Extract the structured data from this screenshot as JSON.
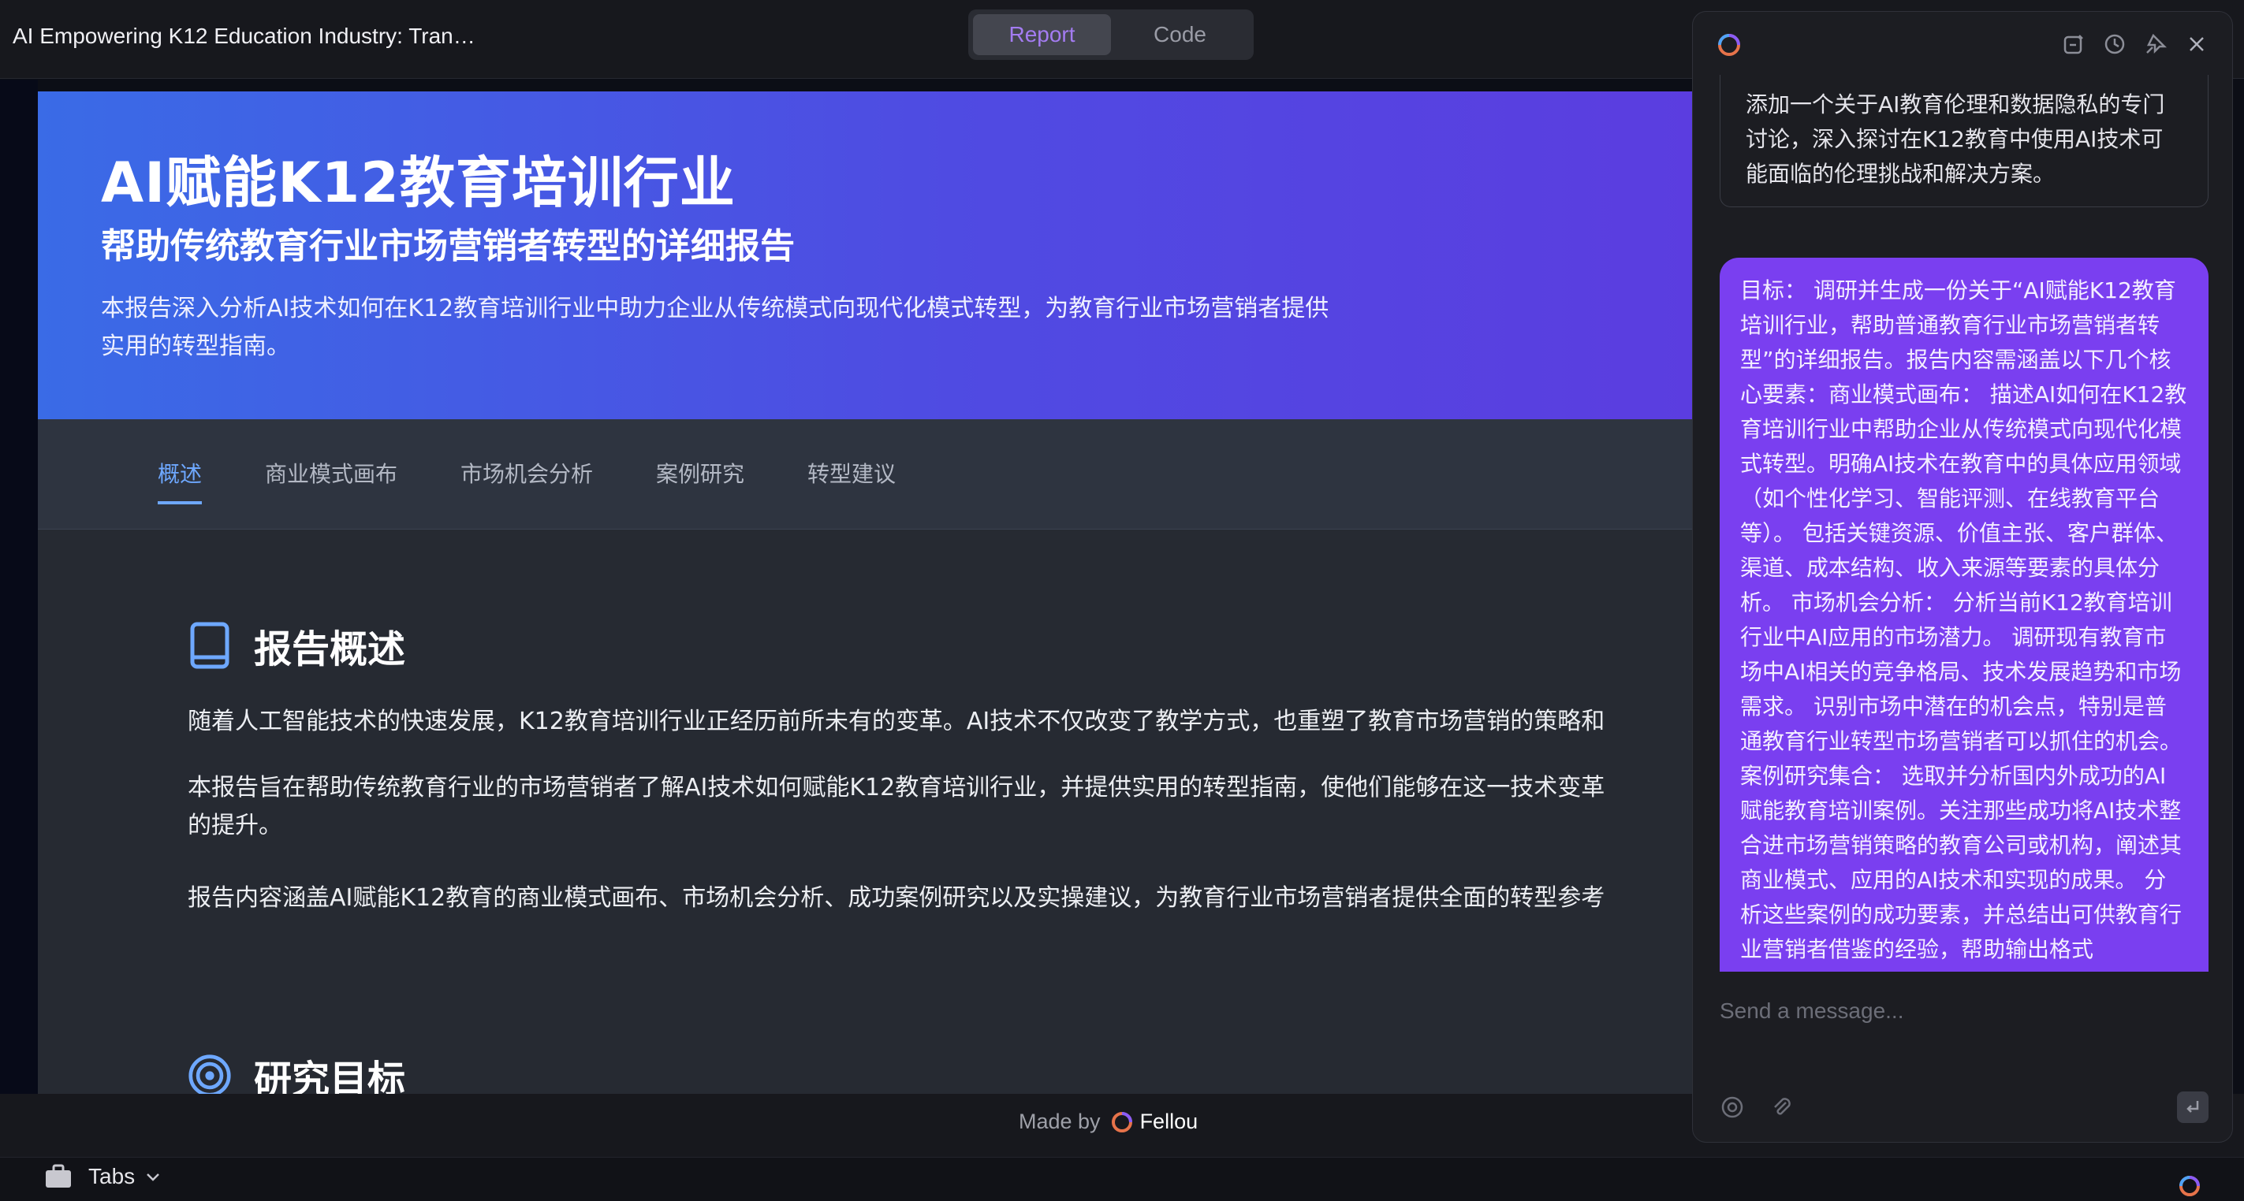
{
  "topbar": {
    "doc_title": "AI Empowering K12 Education Industry: Tran…",
    "segments": [
      "Report",
      "Code"
    ]
  },
  "report": {
    "hero": {
      "title": "AI赋能K12教育培训行业",
      "subtitle": "帮助传统教育行业市场营销者转型的详细报告",
      "description": "本报告深入分析AI技术如何在K12教育培训行业中助力企业从传统模式向现代化模式转型，为教育行业市场营销者提供实用的转型指南。"
    },
    "tabs": [
      "概述",
      "商业模式画布",
      "市场机会分析",
      "案例研究",
      "转型建议"
    ],
    "overview": {
      "heading": "报告概述",
      "paragraphs": [
        "随着人工智能技术的快速发展，K12教育培训行业正经历前所未有的变革。AI技术不仅改变了教学方式，也重塑了教育市场营销的策略和",
        "本报告旨在帮助传统教育行业的市场营销者了解AI技术如何赋能K12教育培训行业，并提供实用的转型指南，使他们能够在这一技术变革",
        "的提升。",
        "报告内容涵盖AI赋能K12教育的商业模式画布、市场机会分析、成功案例研究以及实操建议，为教育行业市场营销者提供全面的转型参考"
      ]
    },
    "goals": {
      "heading": "研究目标"
    }
  },
  "footer": {
    "made_by": "Made by",
    "brand": "Fellou"
  },
  "bottombar": {
    "tabs_label": "Tabs"
  },
  "chat": {
    "previous_message": "添加一个关于AI教育伦理和数据隐私的专门讨论，深入探讨在K12教育中使用AI技术可能面临的伦理挑战和解决方案。",
    "user_message": "目标： 调研并生成一份关于“AI赋能K12教育培训行业，帮助普通教育行业市场营销者转型”的详细报告。报告内容需涵盖以下几个核心要素：商业模式画布： 描述AI如何在K12教育培训行业中帮助企业从传统模式向现代化模式转型。明确AI技术在教育中的具体应用领域（如个性化学习、智能评测、在线教育平台等）。 包括关键资源、价值主张、客户群体、渠道、成本结构、收入来源等要素的具体分析。 市场机会分析： 分析当前K12教育培训行业中AI应用的市场潜力。 调研现有教育市场中AI相关的竞争格局、技术发展趋势和市场需求。 识别市场中潜在的机会点，特别是普通教育行业转型市场营销者可以抓住的机会。 案例研究集合： 选取并分析国内外成功的AI赋能教育培训案例。关注那些成功将AI技术整合进市场营销策略的教育公司或机构，阐述其商业模式、应用的AI技术和实现的成果。 分析这些案例的成功要素，并总结出可供教育行业营销者借鉴的经验，帮助输出格式",
    "input_placeholder": "Send a message..."
  },
  "colors": {
    "accent_purple": "#7a3ff0",
    "tab_active": "#6ea8ff",
    "hero_gradient_start": "#3a6be6",
    "hero_gradient_end": "#5b3de0"
  },
  "icons": [
    "fellou-logo-icon",
    "new-chat-icon",
    "history-icon",
    "pin-icon",
    "close-icon",
    "mention-icon",
    "attach-icon",
    "send-icon",
    "briefcase-icon",
    "chevron-down-icon",
    "book-icon",
    "target-icon"
  ]
}
